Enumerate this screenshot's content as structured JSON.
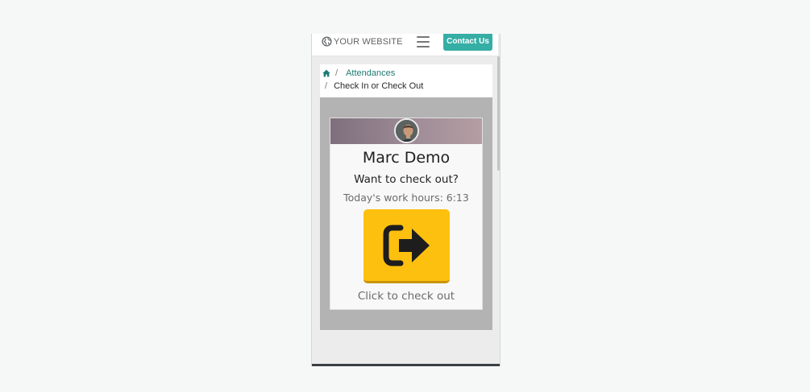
{
  "header": {
    "brand": "YOUR WEBSITE",
    "brand_icon": "globe-icon",
    "menu_icon": "hamburger-menu-icon",
    "contact_label": "Contact Us"
  },
  "breadcrumb": {
    "home_icon": "home-icon",
    "separator": "/",
    "items": [
      {
        "label": "Attendances"
      },
      {
        "label": "Check In or Check Out"
      }
    ]
  },
  "card": {
    "employee_name": "Marc Demo",
    "question": "Want to check out?",
    "work_hours": "Today's work hours: 6:13",
    "button_icon": "sign-out-icon",
    "caption": "Click to check out"
  },
  "colors": {
    "accent": "#35aea5",
    "button": "#fdc00f",
    "link": "#1f7a74",
    "panel": "#b3b3b3"
  }
}
